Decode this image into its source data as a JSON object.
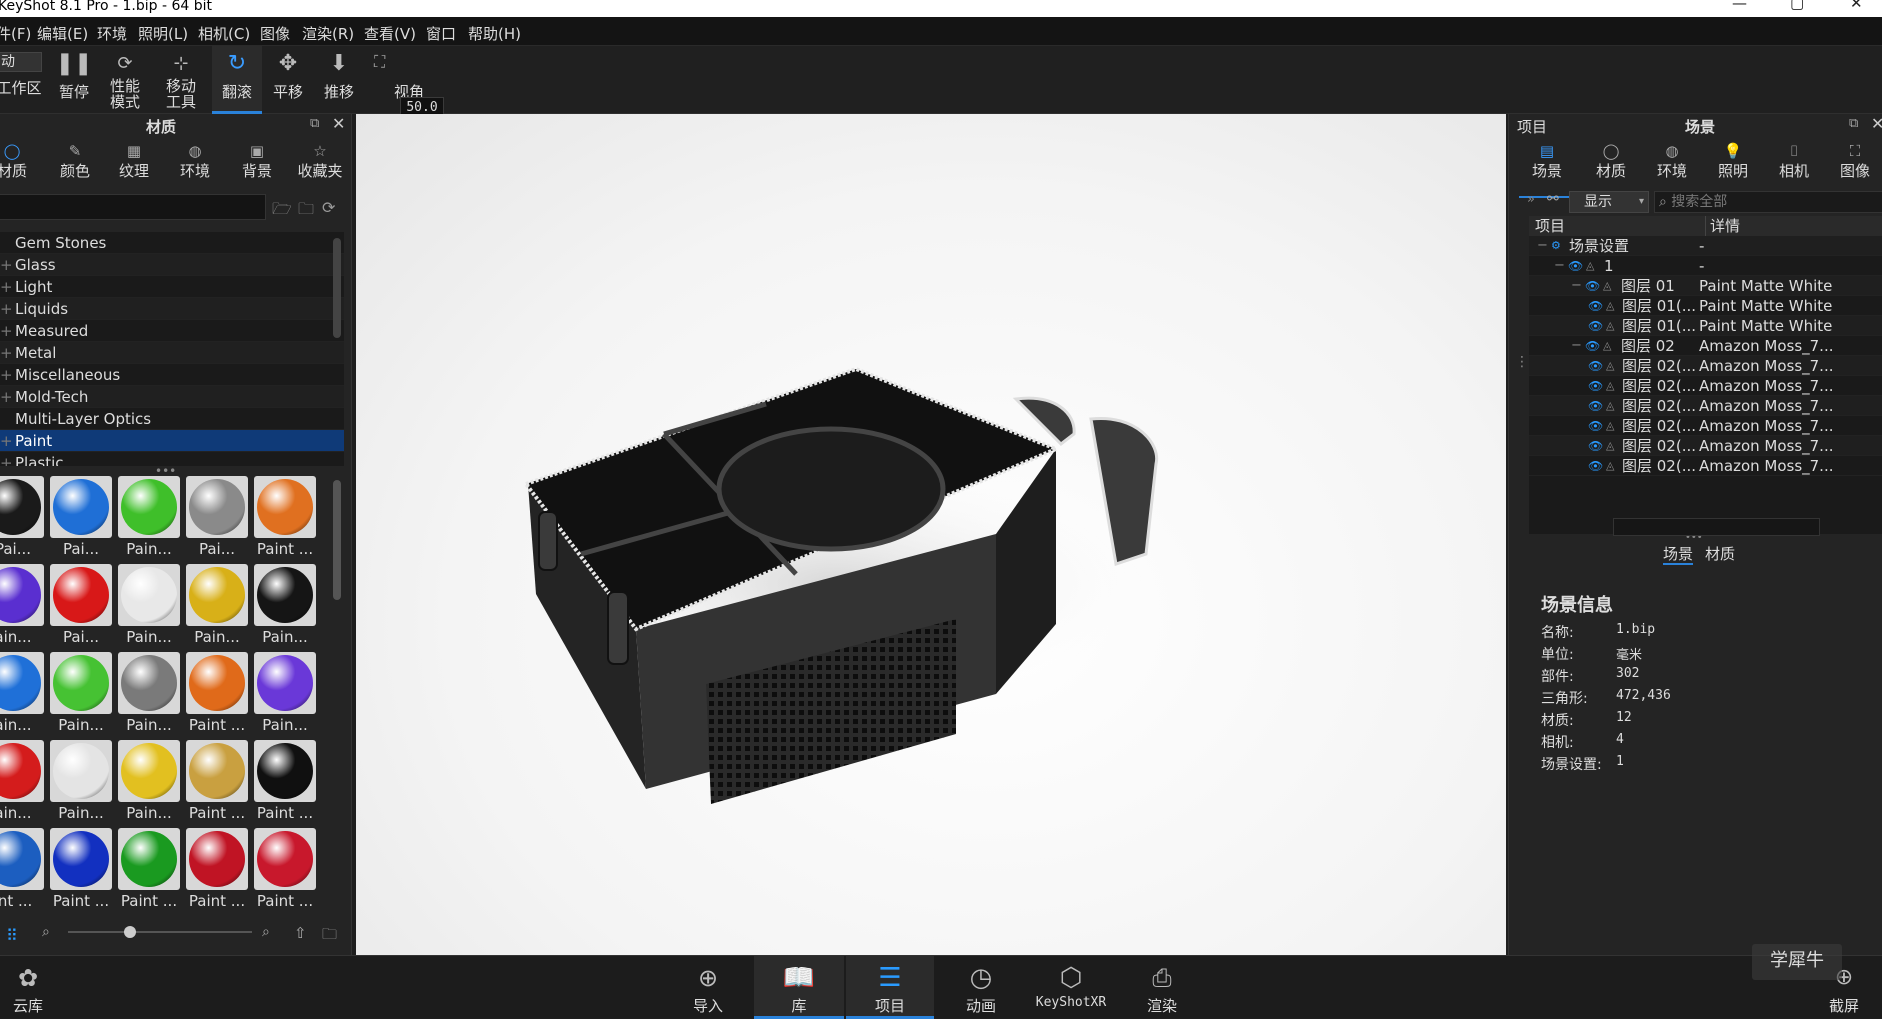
{
  "window": {
    "title": "KeyShot 8.1 Pro  - 1.bip  - 64 bit",
    "controls": [
      "—",
      "▢",
      "✕"
    ]
  },
  "menu": [
    "件(F)",
    "编辑(E)",
    "环境",
    "照明(L)",
    "相机(C)",
    "图像",
    "渲染(R)",
    "查看(V)",
    "窗口",
    "帮助(H)"
  ],
  "toolbar": {
    "workspace_select": "动",
    "workspace_label": "工作区",
    "pause": "暂停",
    "perf1": "性能",
    "perf2": "模式",
    "move1": "移动",
    "move2": "工具",
    "tumble": "翻滚",
    "pan": "平移",
    "dolly": "推移",
    "fov_value": "50.0",
    "fov_label": "视角"
  },
  "left_panel": {
    "title": "材质",
    "tabs": [
      "材质",
      "颜色",
      "纹理",
      "环境",
      "背景",
      "收藏夹"
    ],
    "categories": [
      "Gem Stones",
      "Glass",
      "Light",
      "Liquids",
      "Measured",
      "Metal",
      "Miscellaneous",
      "Mold-Tech",
      "Multi-Layer Optics",
      "Paint",
      "Plastic"
    ],
    "selected_category": "Paint",
    "swatches": [
      {
        "label": "Pai...",
        "color": "#1a1a1a"
      },
      {
        "label": "Pai...",
        "color": "#1f6fd6"
      },
      {
        "label": "Pain...",
        "color": "#3fbf2a"
      },
      {
        "label": "Pai...",
        "color": "#8a8a8a"
      },
      {
        "label": "Paint ...",
        "color": "#e07020"
      },
      {
        "label": "ain...",
        "color": "#5a2fd0"
      },
      {
        "label": "Pai...",
        "color": "#d81818"
      },
      {
        "label": "Pain...",
        "color": "#e8e8e8"
      },
      {
        "label": "Pain...",
        "color": "#d8b018"
      },
      {
        "label": "Pain...",
        "color": "#151515"
      },
      {
        "label": "ain...",
        "color": "#1f70d8"
      },
      {
        "label": "Pain...",
        "color": "#46c233"
      },
      {
        "label": "Pain...",
        "color": "#7a7a7a"
      },
      {
        "label": "Paint ...",
        "color": "#e06a1a"
      },
      {
        "label": "Pain...",
        "color": "#6a38d8"
      },
      {
        "label": "ain...",
        "color": "#d41c1c"
      },
      {
        "label": "Pain...",
        "color": "#e4e4e4"
      },
      {
        "label": "Pain...",
        "color": "#e2c020"
      },
      {
        "label": "Paint ...",
        "color": "#c9a040"
      },
      {
        "label": "Paint ...",
        "color": "#101010"
      },
      {
        "label": "int ...",
        "color": "#1c5ec0"
      },
      {
        "label": "Paint ...",
        "color": "#1230c0"
      },
      {
        "label": "Paint ...",
        "color": "#1a9a20"
      },
      {
        "label": "Paint ...",
        "color": "#c01424"
      },
      {
        "label": "Paint ...",
        "color": "#c8182c"
      }
    ]
  },
  "right_panel": {
    "left_title": "项目",
    "title": "场景",
    "tabs": [
      "场景",
      "材质",
      "环境",
      "照明",
      "相机",
      "图像"
    ],
    "filter_dropdown": "显示",
    "search_placeholder": "搜索全部",
    "tree_cols": [
      "项目",
      "详情"
    ],
    "tree": [
      {
        "name": "场景设置",
        "detail": "-",
        "level": 0
      },
      {
        "name": "1",
        "detail": "-",
        "level": 1
      },
      {
        "name": "图层 01",
        "detail": "Paint Matte White",
        "level": 2
      },
      {
        "name": "图层 01(...",
        "detail": "Paint Matte White",
        "level": 3
      },
      {
        "name": "图层 01(...",
        "detail": "Paint Matte White",
        "level": 3
      },
      {
        "name": "图层 02",
        "detail": "Amazon Moss_7...",
        "level": 2
      },
      {
        "name": "图层 02(...",
        "detail": "Amazon Moss_7...",
        "level": 3
      },
      {
        "name": "图层 02(...",
        "detail": "Amazon Moss_7...",
        "level": 3
      },
      {
        "name": "图层 02(...",
        "detail": "Amazon Moss_7...",
        "level": 3
      },
      {
        "name": "图层 02(...",
        "detail": "Amazon Moss_7...",
        "level": 3
      },
      {
        "name": "图层 02(...",
        "detail": "Amazon Moss_7...",
        "level": 3
      },
      {
        "name": "图层 02(...",
        "detail": "Amazon Moss_7...",
        "level": 3
      }
    ],
    "subtabs": [
      "场景",
      "材质"
    ],
    "info_title": "场景信息",
    "info": [
      {
        "k": "名称:",
        "v": "1.bip"
      },
      {
        "k": "单位:",
        "v": "毫米"
      },
      {
        "k": "部件:",
        "v": "302"
      },
      {
        "k": "三角形:",
        "v": "472,436"
      },
      {
        "k": "材质:",
        "v": "12"
      },
      {
        "k": "相机:",
        "v": "4"
      },
      {
        "k": "场景设置:",
        "v": "1"
      }
    ]
  },
  "bottom": {
    "cloud": "云库",
    "buttons": [
      "导入",
      "库",
      "项目",
      "动画",
      "KeyShotXR",
      "渲染"
    ],
    "screenshot": "截屏",
    "watermark": "学犀牛"
  },
  "colors": {
    "accent": "#2a82da",
    "selection": "#0f3a78"
  }
}
